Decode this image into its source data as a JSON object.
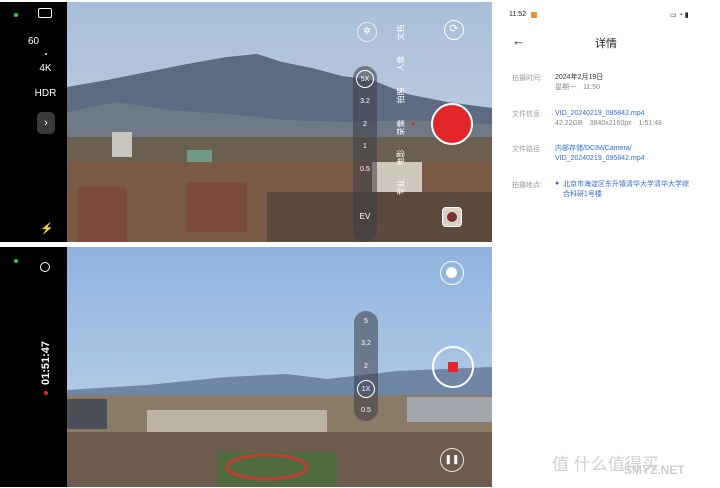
{
  "camera_top": {
    "settings": {
      "fps": "60",
      "resolution": "4K",
      "hdr": "HDR"
    },
    "zoom_levels": [
      "5X",
      "3.2",
      "2",
      "1",
      "0.5"
    ],
    "ev_label": "EV",
    "modes": [
      "文档",
      "人像",
      "拍照",
      "录像",
      "电影",
      "专业"
    ],
    "active_mode_index": 3,
    "colors": {
      "record": "#e3262a"
    }
  },
  "camera_bottom": {
    "recording_time": "01:51:47",
    "zoom_levels": [
      "5",
      "3.2",
      "2",
      "1X",
      "0.5"
    ],
    "colors": {
      "stop": "#e3262a"
    }
  },
  "details": {
    "status_time": "11:52",
    "title": "详情",
    "shot_time_label": "拍摄时间:",
    "shot_date": "2024年2月19日",
    "shot_weekday_time": "星期一　11:50",
    "file_info_label": "文件信息:",
    "file_name": "VID_20240219_095842.mp4",
    "file_meta": "42.22GB　3840x2160px　1:51:48",
    "file_path_label": "文件路径:",
    "file_path_line1": "内部存储/DCIM/Camera/",
    "file_path_line2": "VID_20240219_095842.mp4",
    "location_label": "拍摄地点:",
    "location_line1": "北京市海淀区东升镇清华大学清华大学综",
    "location_line2": "合科研1号楼"
  },
  "watermark": {
    "text": "值 什么值得买",
    "site": "SMYZ.NET"
  }
}
